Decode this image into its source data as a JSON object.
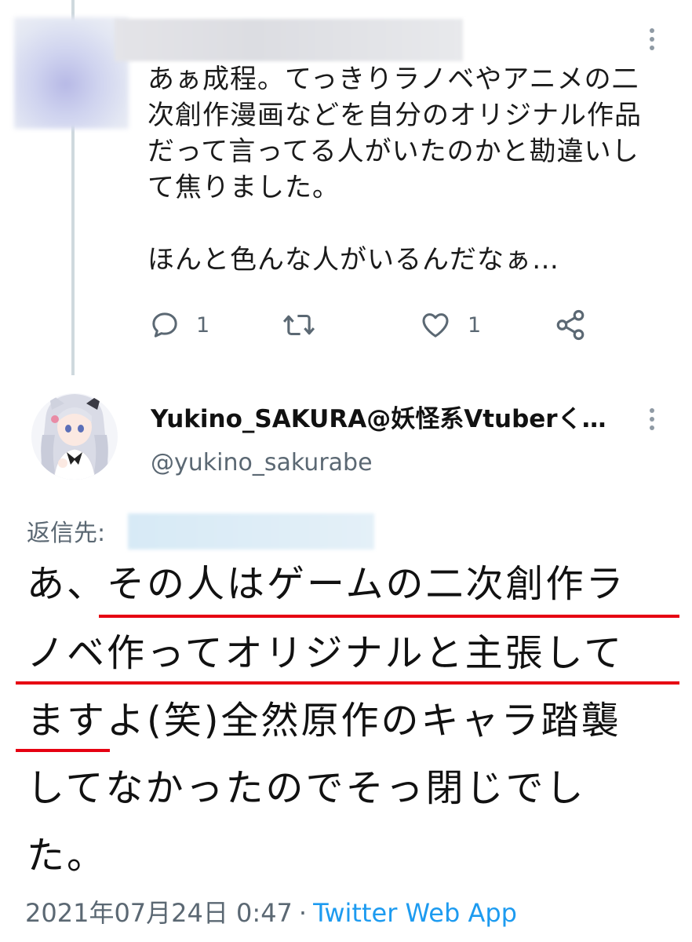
{
  "parent_tweet": {
    "text": "あぁ成程。てっきりラノベやアニメの二\n次創作漫画などを自分のオリジナル作品\nだって言ってる人がいたのかと勘違いし\nて焦りました。\n\nほんと色んな人がいるんだなぁ…",
    "actions": {
      "reply_icon": "reply-bubble-icon",
      "reply_count": "1",
      "retweet_icon": "retweet-icon",
      "like_icon": "heart-icon",
      "like_count": "1",
      "share_icon": "share-icon"
    }
  },
  "tweet": {
    "display_name": "Yukino_SAKURA@妖怪系Vtuberく…",
    "handle": "@yukino_sakurabe",
    "replying_to_label": "返信先:",
    "text_lines": [
      "あ、その人はゲームの二次創作ラ",
      "ノベ作ってオリジナルと主張して",
      "ますよ(笑)全然原作のキャラ踏襲",
      "してなかったのでそっ閉じでし",
      "た。"
    ],
    "timestamp": "2021年07月24日 0:47",
    "separator": "·",
    "source": "Twitter Web App"
  },
  "colors": {
    "underline": "#e60012",
    "link": "#1d9bf0",
    "muted": "#5b6873"
  }
}
